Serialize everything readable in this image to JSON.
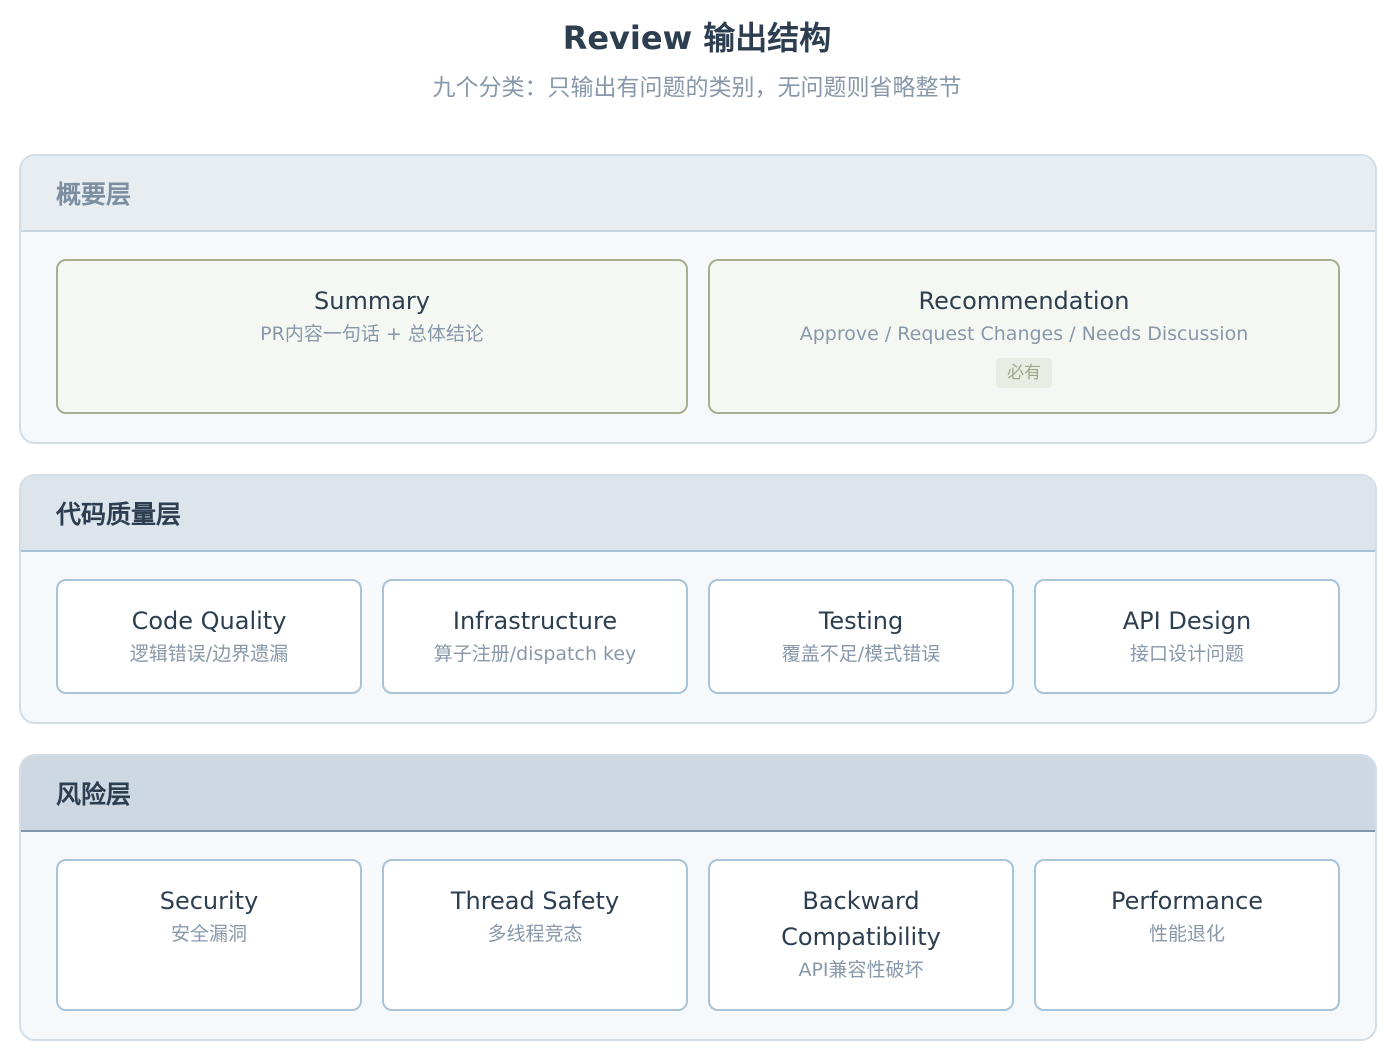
{
  "header": {
    "title": "Review 输出结构",
    "subtitle": "九个分类：只输出有问题的类别，无问题则省略整节"
  },
  "layers": [
    {
      "name": "概要层",
      "cards": [
        {
          "title": "Summary",
          "desc": "PR内容一句话 + 总体结论"
        },
        {
          "title": "Recommendation",
          "desc": "Approve / Request Changes / Needs Discussion",
          "badge": "必有"
        }
      ]
    },
    {
      "name": "代码质量层",
      "cards": [
        {
          "title": "Code Quality",
          "desc": "逻辑错误/边界遗漏"
        },
        {
          "title": "Infrastructure",
          "desc": "算子注册/dispatch key"
        },
        {
          "title": "Testing",
          "desc": "覆盖不足/模式错误"
        },
        {
          "title": "API Design",
          "desc": "接口设计问题"
        }
      ]
    },
    {
      "name": "风险层",
      "cards": [
        {
          "title": "Security",
          "desc": "安全漏洞"
        },
        {
          "title": "Thread Safety",
          "desc": "多线程竞态"
        },
        {
          "title": "Backward Compatibility",
          "desc": "API兼容性破坏"
        },
        {
          "title": "Performance",
          "desc": "性能退化"
        }
      ]
    }
  ]
}
